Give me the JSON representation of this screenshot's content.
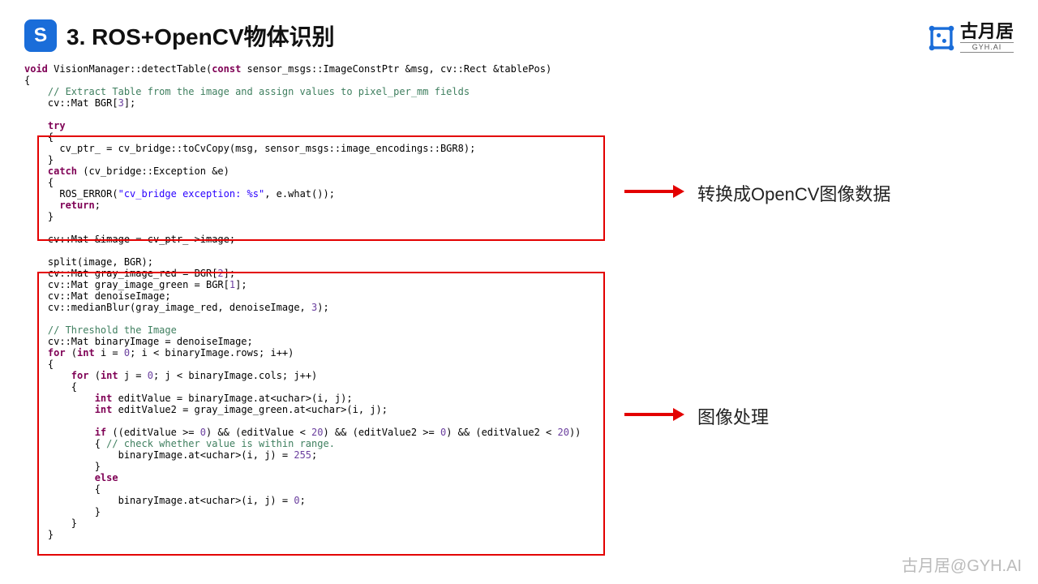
{
  "header": {
    "title": "3. ROS+OpenCV物体识别",
    "logo_letter": "S"
  },
  "brand": {
    "cn": "古月居",
    "en": "GYH.AI"
  },
  "annotation1": "转换成OpenCV图像数据",
  "annotation2": "图像处理",
  "watermark": "古月居@GYH.AI",
  "code": {
    "line1_void": "void",
    "line1_rest": " VisionManager::detectTable(",
    "line1_const": "const",
    "line1_rest2": " sensor_msgs::ImageConstPtr &msg, cv::Rect &tablePos)",
    "line2": "{",
    "line3_cmt": "    // Extract Table from the image and assign values to pixel_per_mm fields",
    "line4a": "    cv::Mat BGR[",
    "line4n": "3",
    "line4b": "];",
    "blank1": "",
    "try": "    try",
    "try_open": "    {",
    "try_body": "      cv_ptr_ = cv_bridge::toCvCopy(msg, sensor_msgs::image_encodings::BGR8);",
    "try_close": "    }",
    "catch": "    catch",
    "catch_rest": " (cv_bridge::Exception &e)",
    "catch_open": "    {",
    "ros_err_a": "      ROS_ERROR(",
    "ros_err_str": "\"cv_bridge exception: %s\"",
    "ros_err_b": ", e.what());",
    "return": "      return",
    "return_semi": ";",
    "catch_close": "    }",
    "blank2": "",
    "img_line": "    cv::Mat &image = cv_ptr_->image;",
    "blank3": "",
    "split": "    split(image, BGR);",
    "gray_r_a": "    cv::Mat gray_image_red = BGR[",
    "gray_r_n": "2",
    "gray_r_b": "];",
    "gray_g_a": "    cv::Mat gray_image_green = BGR[",
    "gray_g_n": "1",
    "gray_g_b": "];",
    "denoise_decl": "    cv::Mat denoiseImage;",
    "median_a": "    cv::medianBlur(gray_image_red, denoiseImage, ",
    "median_n": "3",
    "median_b": ");",
    "blank4": "",
    "cmt_thresh": "    // Threshold the Image",
    "binimg": "    cv::Mat binaryImage = denoiseImage;",
    "for1_a": "    for",
    "for1_b": " (",
    "for1_int": "int",
    "for1_c": " i = ",
    "for1_n0": "0",
    "for1_d": "; i < binaryImage.rows; i++)",
    "for1_open": "    {",
    "for2_a": "        for",
    "for2_b": " (",
    "for2_int": "int",
    "for2_c": " j = ",
    "for2_n0": "0",
    "for2_d": "; j < binaryImage.cols; j++)",
    "for2_open": "        {",
    "ev1_a": "            ",
    "ev1_int": "int",
    "ev1_b": " editValue = binaryImage.at<uchar>(i, j);",
    "ev2_a": "            ",
    "ev2_int": "int",
    "ev2_b": " editValue2 = gray_image_green.at<uchar>(i, j);",
    "blank5": "",
    "if_a": "            if",
    "if_b": " ((editValue >= ",
    "if_n0a": "0",
    "if_c": ") && (editValue < ",
    "if_n20a": "20",
    "if_d": ") && (editValue2 >= ",
    "if_n0b": "0",
    "if_e": ") && (editValue2 < ",
    "if_n20b": "20",
    "if_f": "))",
    "if_open_a": "            { ",
    "if_open_cmt": "// check whether value is within range.",
    "assign255_a": "                binaryImage.at<uchar>(i, j) = ",
    "assign255_n": "255",
    "assign255_b": ";",
    "if_close": "            }",
    "else": "            else",
    "else_open": "            {",
    "assign0_a": "                binaryImage.at<uchar>(i, j) = ",
    "assign0_n": "0",
    "assign0_b": ";",
    "else_close": "            }",
    "for2_close": "        }",
    "for1_close": "    }"
  }
}
